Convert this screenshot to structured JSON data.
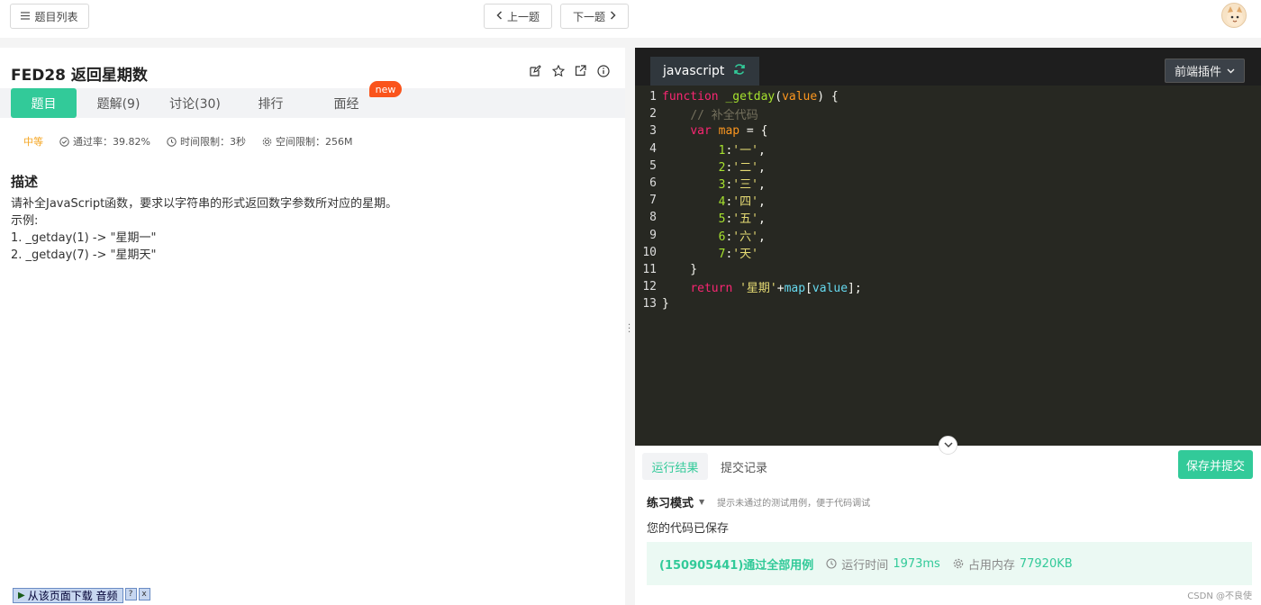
{
  "topbar": {
    "list_label": "题目列表",
    "prev_label": "上一题",
    "next_label": "下一题"
  },
  "problem": {
    "title": "FED28  返回星期数",
    "tabs": [
      "题目",
      "题解(9)",
      "讨论(30)",
      "排行",
      "面经"
    ],
    "new_badge": "new",
    "difficulty": "中等",
    "pass_rate": "通过率：39.82%",
    "time_limit": "时间限制：3秒",
    "space_limit": "空间限制：256M",
    "desc_heading": "描述",
    "desc_lines": [
      "请补全JavaScript函数，要求以字符串的形式返回数字参数所对应的星期。",
      "示例:",
      "1. _getday(1) -> \"星期一\"",
      "2. _getday(7) -> \"星期天\""
    ]
  },
  "download_bar": {
    "label": "从该页面下载 音频",
    "help": "?",
    "close": "x"
  },
  "editor": {
    "language": "javascript",
    "plugin_label": "前端插件",
    "line_numbers": [
      "1",
      "2",
      "3",
      "4",
      "5",
      "6",
      "7",
      "8",
      "9",
      "10",
      "11",
      "12",
      "13"
    ],
    "code_lines": [
      "function _getday(value) {",
      "    // 补全代码",
      "    var map = {",
      "        1:'一',",
      "        2:'二',",
      "        3:'三',",
      "        4:'四',",
      "        5:'五',",
      "        6:'六',",
      "        7:'天'",
      "    }",
      "    return '星期'+map[value];",
      "}"
    ]
  },
  "result_panel": {
    "tab_result": "运行结果",
    "tab_history": "提交记录",
    "submit_label": "保存并提交",
    "mode_label": "练习模式",
    "mode_hint": "提示未通过的测试用例，便于代码调试",
    "saved_msg": "您的代码已保存",
    "pass_msg": "(150905441)通过全部用例",
    "run_time_label": "运行时间",
    "run_time_value": "1973ms",
    "memory_label": "占用内存",
    "memory_value": "77920KB"
  },
  "watermark": "CSDN @不良使",
  "colors": {
    "accent": "#32ca99",
    "badge": "#fa541c",
    "editor_bg": "#272822"
  }
}
